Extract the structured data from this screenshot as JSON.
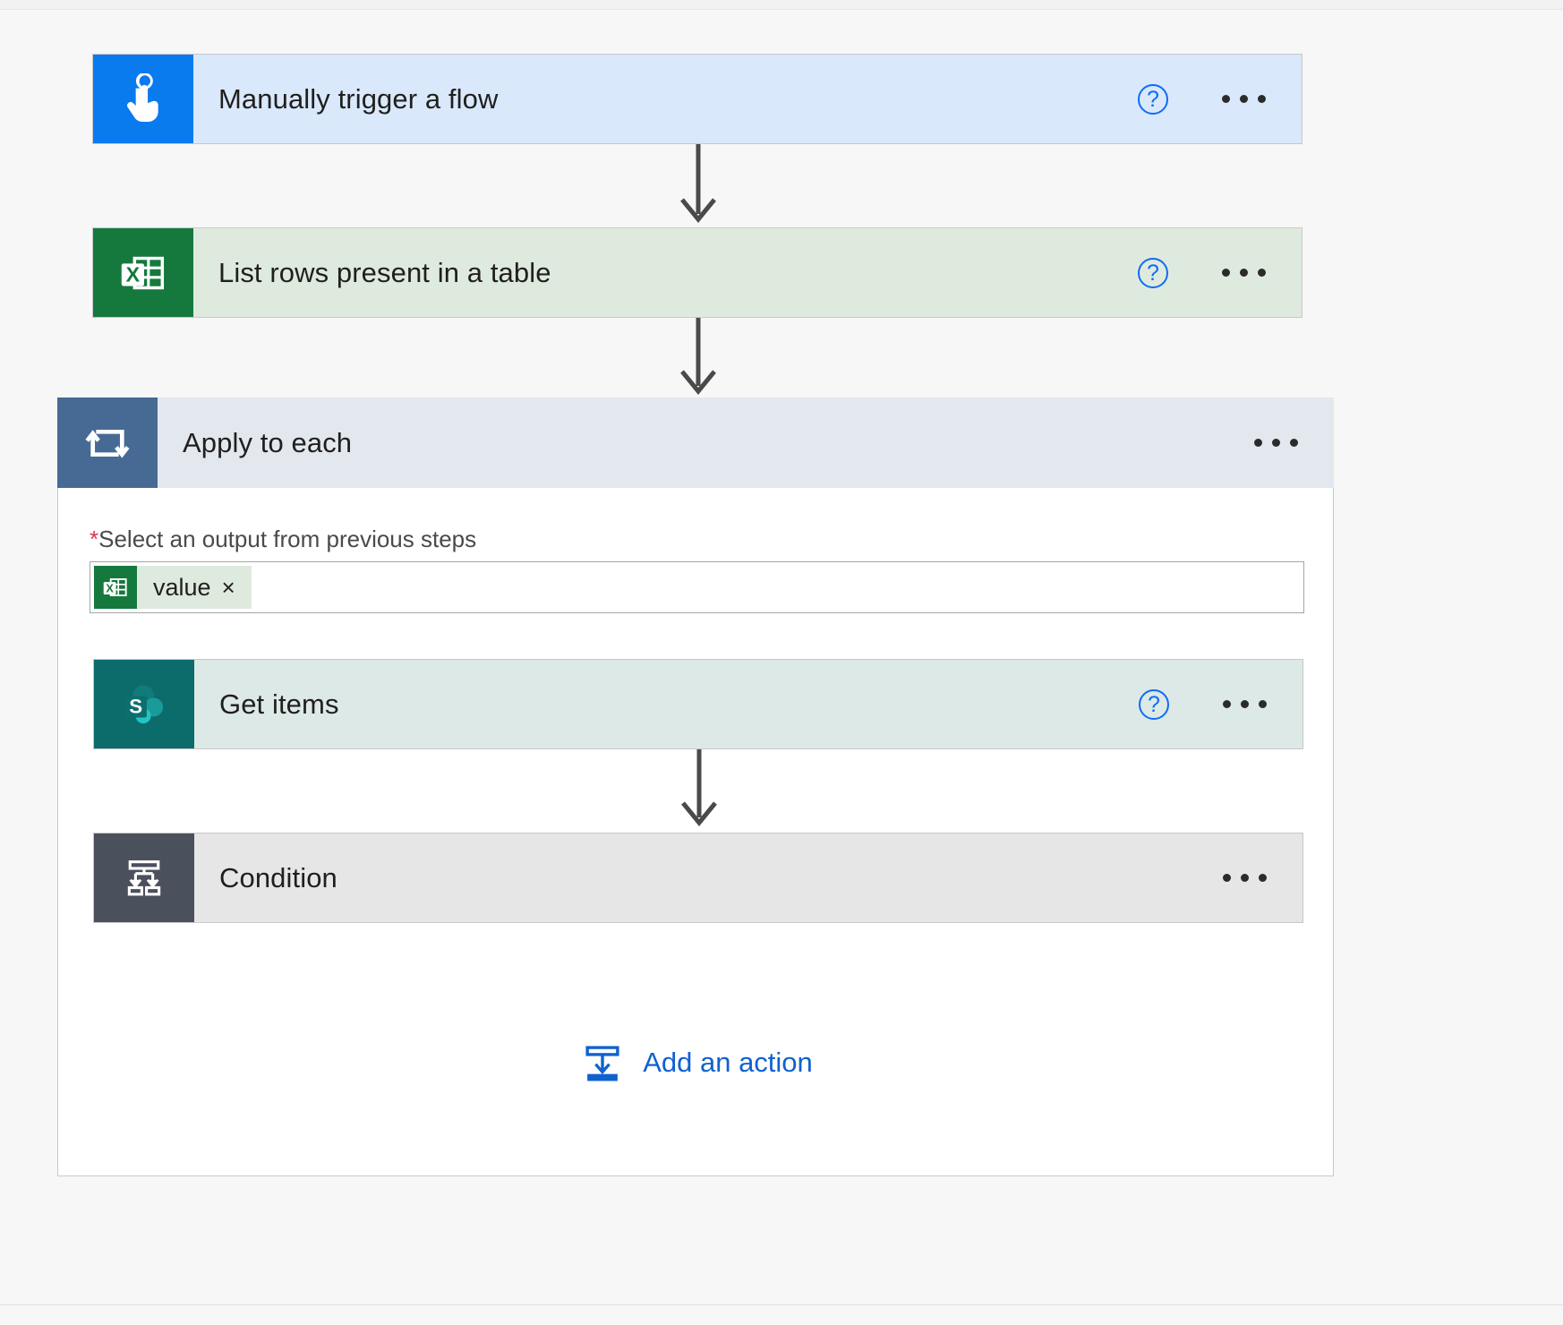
{
  "flow": {
    "steps": [
      {
        "id": "manually-trigger-a-flow",
        "title": "Manually trigger a flow",
        "icon": "touch-trigger-icon",
        "theme": "trigger",
        "has_help": true,
        "has_menu": true
      },
      {
        "id": "list-rows-present-in-a-table",
        "title": "List rows present in a table",
        "icon": "excel-icon",
        "theme": "excel",
        "has_help": true,
        "has_menu": true
      }
    ],
    "loop": {
      "title": "Apply to each",
      "icon": "loop-icon",
      "theme": "loop",
      "has_help": false,
      "has_menu": true,
      "field": {
        "required_marker": "*",
        "label": "Select an output from previous steps",
        "token": {
          "text": "value",
          "icon": "excel-icon",
          "remove_label": "×"
        }
      },
      "children": [
        {
          "id": "get-items",
          "title": "Get items",
          "icon": "sharepoint-icon",
          "theme": "sharepoint",
          "has_help": true,
          "has_menu": true
        },
        {
          "id": "condition",
          "title": "Condition",
          "icon": "condition-icon",
          "theme": "condition",
          "has_help": false,
          "has_menu": true
        }
      ],
      "add_action": {
        "label": "Add an action",
        "icon": "add-action-icon"
      }
    },
    "icons": {
      "help": "?",
      "menu": "•••"
    },
    "colors": {
      "trigger_bg": "#d9e8fb",
      "trigger_icon_bg": "#0a7aef",
      "excel_bg": "#dfeadf",
      "excel_icon_bg": "#15793e",
      "sharepoint_bg": "#dde9e7",
      "sharepoint_icon_bg": "#0c6b6b",
      "loop_bg": "#e3e7ee",
      "loop_icon_bg": "#466a94",
      "condition_bg": "#e6e6e6",
      "condition_icon_bg": "#4a505c",
      "link": "#0f62d0",
      "required": "#d9364c",
      "connector": "#4a4a4a"
    }
  }
}
